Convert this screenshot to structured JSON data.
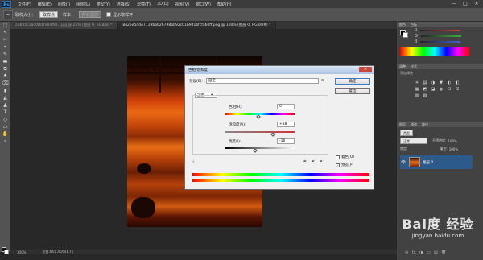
{
  "app": {
    "logo": "Ps",
    "menus": [
      "文件(F)",
      "编辑(E)",
      "图像(I)",
      "图层(L)",
      "类型(Y)",
      "选择(S)",
      "滤镜(T)",
      "3D(D)",
      "视图(V)",
      "窗口(W)",
      "帮助(H)"
    ],
    "window_controls": [
      "—",
      "□",
      "✕"
    ]
  },
  "options": {
    "size_label": "取样大小：",
    "size_value": "取样点",
    "sample_label": "样本：",
    "sample_value": "所有图层",
    "show_ring": "显示取样环"
  },
  "tabs": [
    {
      "label": "2ab95c1ad0ffd7e04f95…jpg @ 25% (图层 0, RGB/8) *"
    },
    {
      "label": "8425e5dde7119bb626798bb92c01b9d16fcfa60ff.png @ 100% (图层 0, RGB/8#) *"
    }
  ],
  "tools": [
    "⬚",
    "↖",
    "✂",
    "⌖",
    "✎",
    "▬",
    "⧉",
    "♣",
    "⌫",
    "▮",
    "◭",
    "▲",
    "T",
    "◇",
    "▭",
    "✋",
    "⌕"
  ],
  "status": {
    "zoom": "100%",
    "doc": "文档:641.7K/641.7K"
  },
  "panels": {
    "color_tabs": [
      "颜色",
      "色板"
    ],
    "sliders": [
      {
        "label": "R",
        "color": "#d44040"
      },
      {
        "label": "G",
        "color": "#40b040"
      },
      {
        "label": "B",
        "color": "#4060d4"
      }
    ],
    "adj_tabs": [
      "调整",
      "样式"
    ],
    "adj_title": "添加调整",
    "adj_icons": [
      "☀",
      "▤",
      "◑",
      "▼",
      "◐",
      "◧",
      "▦",
      "◩",
      "◪",
      "◉",
      "⊟",
      "⊞",
      "▥",
      "▧"
    ],
    "layer_tabs": [
      "图层",
      "通道",
      "路径"
    ],
    "kind": "类型",
    "mode": "正常",
    "opacity_label": "不透明度:",
    "opacity": "100%",
    "lock": "锁定:",
    "fill_label": "填充:",
    "fill": "100%",
    "layer_name": "图层 0",
    "layer_eye": "👁",
    "bottom_icons": [
      "⊕",
      "fx",
      "◑",
      "▭",
      "▤",
      "🗑"
    ]
  },
  "dialog": {
    "title": "色相/饱和度",
    "preset_label": "预设(E):",
    "preset_value": "自定",
    "channel": "全图",
    "hue_label": "色相(H):",
    "hue": "0",
    "sat_label": "饱和度(A):",
    "sat": "+38",
    "light_label": "明度(I):",
    "light": "-16",
    "ok": "确定",
    "cancel": "复位",
    "colorize": "着色(O)",
    "preview": "预览(P)",
    "check": "✓",
    "close": "✕",
    "dropdown_arrow": "▾",
    "gear": "≡",
    "eyedroppers": [
      "✒",
      "✒",
      "✒"
    ],
    "hand": "☝"
  },
  "watermark": {
    "line1": "Bai度 经验",
    "line2": "jingyan.baidu.com"
  }
}
